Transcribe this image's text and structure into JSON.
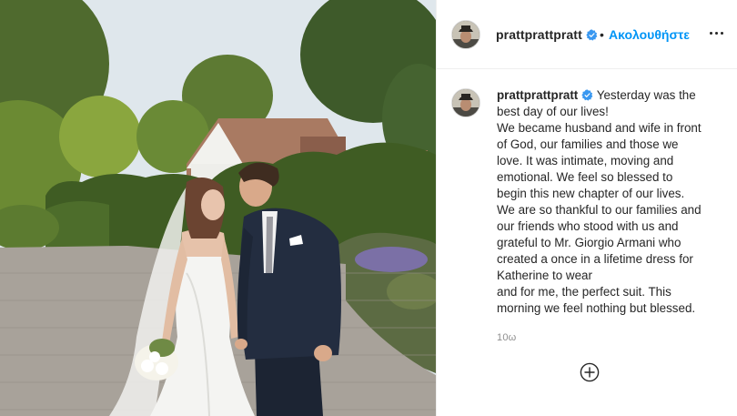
{
  "colors": {
    "accent_link": "#0095f6",
    "verified_badge": "#3897f0",
    "text": "#262626",
    "muted": "#8e8e8e",
    "divider": "#efefef"
  },
  "post": {
    "image_alt": "Wedding photo of a bride in a white strapless gown holding a white bouquet and a groom in a navy suit on a brick driveway beside a hedge and house",
    "header": {
      "username": "prattprattpratt",
      "verified_icon": "verified-badge-icon",
      "separator": "•",
      "follow_label": "Ακολουθήστε",
      "more_icon": "more-options-icon"
    },
    "caption": {
      "username": "prattprattpratt",
      "first_line": "Yesterday was the",
      "lines": [
        "best day of our lives!",
        "We became husband and wife in front",
        "of God, our families and those we",
        "love. It was intimate, moving and",
        "emotional. We feel so blessed to",
        "begin this new chapter of our lives.",
        "We are so thankful to our families and",
        "our friends who stood with us and",
        "grateful to Mr. Giorgio Armani who",
        "created a once in a lifetime dress for",
        "Katherine to wear",
        "and for me, the perfect suit. This",
        "morning we feel nothing but blessed."
      ]
    },
    "time_ago": "10ω",
    "load_more_icon": "plus-circle-icon"
  }
}
